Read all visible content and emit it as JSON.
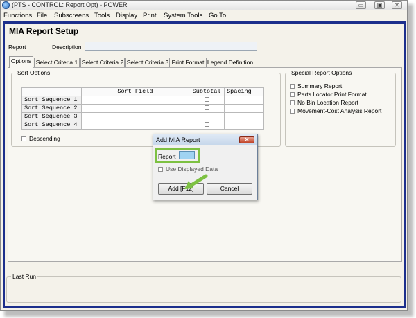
{
  "window": {
    "title": "(PTS - CONTROL: Report Opt) - POWER",
    "buttons": {
      "minimize": "▭",
      "maximize": "▣",
      "close": "✕"
    }
  },
  "menu": [
    "Functions",
    "File",
    "Subscreens",
    "Tools",
    "Display",
    "Print",
    "System Tools",
    "Go To"
  ],
  "page": {
    "title": "MIA Report Setup",
    "report_label": "Report",
    "description_label": "Description",
    "report_value": "",
    "description_value": ""
  },
  "tabs": [
    "Options",
    "Select Criteria 1",
    "Select Criteria 2",
    "Select Criteria 3",
    "Print Format",
    "Legend Definition"
  ],
  "active_tab": "Options",
  "sort_options": {
    "title": "Sort Options",
    "columns": [
      "",
      "Sort Field",
      "Subtotal",
      "Spacing"
    ],
    "rows": [
      {
        "label": "Sort Sequence 1",
        "field": "",
        "subtotal": false,
        "spacing": ""
      },
      {
        "label": "Sort Sequence 2",
        "field": "",
        "subtotal": false,
        "spacing": ""
      },
      {
        "label": "Sort Sequence 3",
        "field": "",
        "subtotal": false,
        "spacing": ""
      },
      {
        "label": "Sort Sequence 4",
        "field": "",
        "subtotal": false,
        "spacing": ""
      }
    ],
    "descending_label": "Descending"
  },
  "special_options": {
    "title": "Special Report Options",
    "items": [
      "Summary Report",
      "Parts Locator Print Format",
      "No Bin Location Report",
      "Movement-Cost Analysis Report"
    ]
  },
  "dialog": {
    "title": "Add MIA Report",
    "close": "✕",
    "report_label": "Report",
    "report_value": "",
    "use_displayed_label": "Use Displayed Data",
    "add_button": "Add [F12]",
    "cancel_button": "Cancel"
  },
  "last_run": {
    "title": "Last Run"
  },
  "colors": {
    "frame": "#1c2f8c",
    "highlight": "#7dc142",
    "field_fill": "#9fd3f2"
  }
}
